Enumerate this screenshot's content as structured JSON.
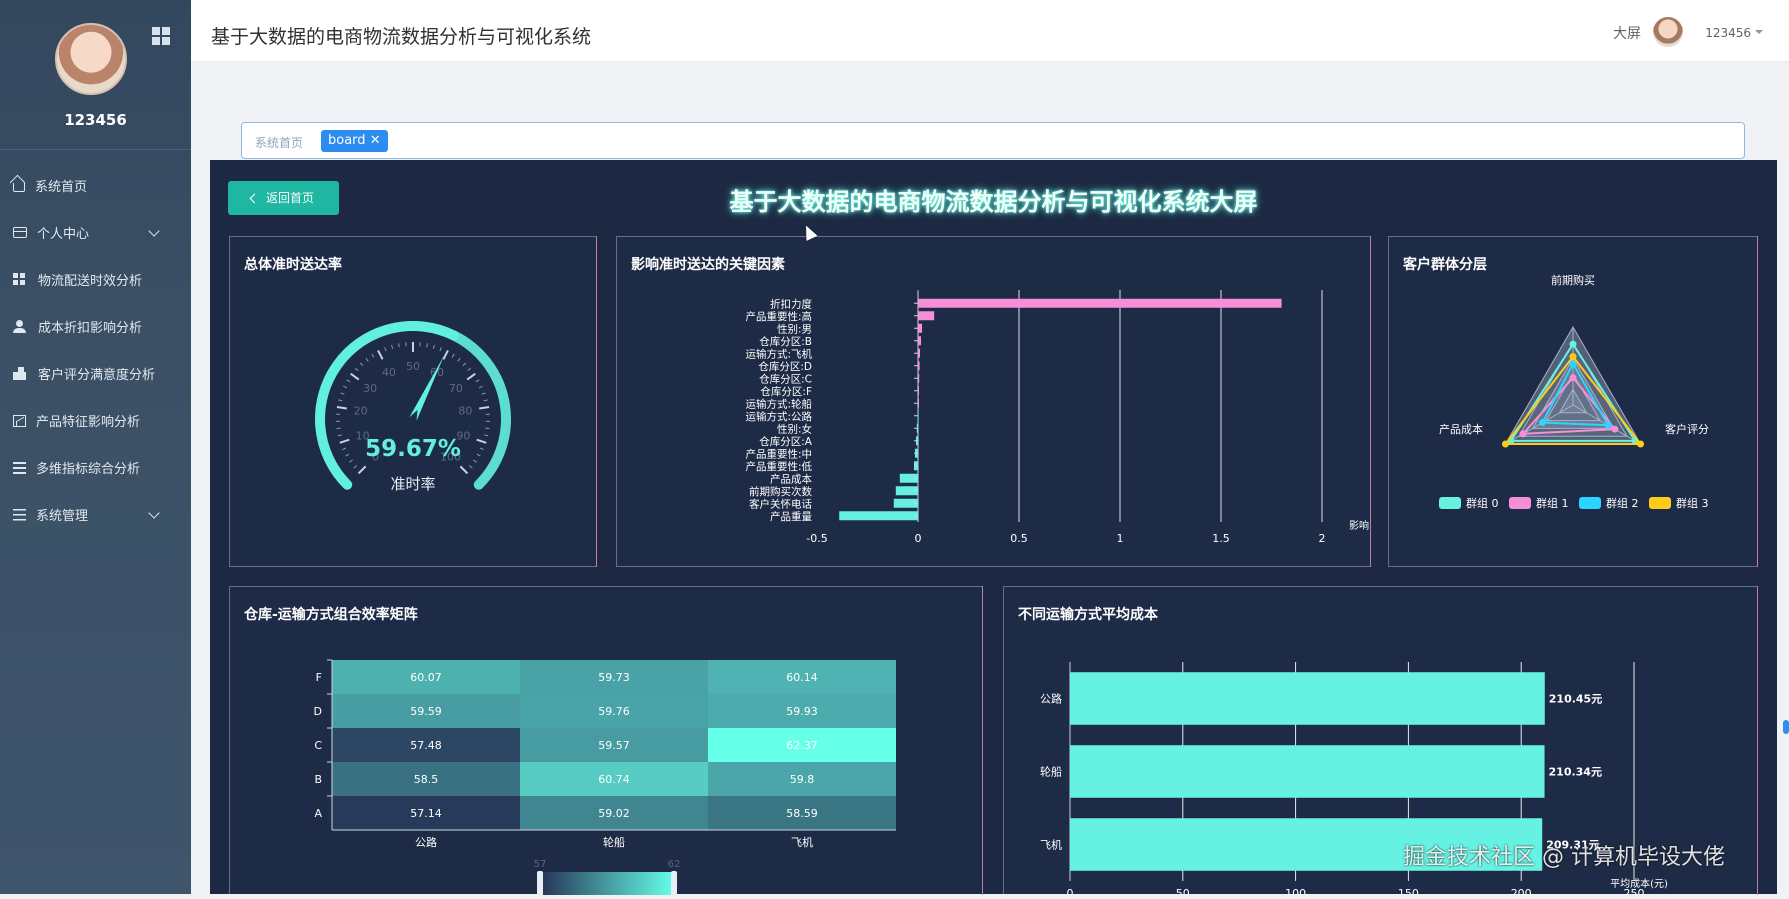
{
  "sidebar": {
    "username": "123456",
    "items": [
      {
        "icon": "home-icon",
        "label": "系统首页",
        "expand": false
      },
      {
        "icon": "id-card-icon",
        "label": "个人中心",
        "expand": true
      },
      {
        "icon": "grid-icon",
        "label": "物流配送时效分析",
        "expand": false
      },
      {
        "icon": "user-icon",
        "label": "成本折扣影响分析",
        "expand": false
      },
      {
        "icon": "hand-icon",
        "label": "客户评分满意度分析",
        "expand": false
      },
      {
        "icon": "line-chart-icon",
        "label": "产品特征影响分析",
        "expand": false
      },
      {
        "icon": "list-icon",
        "label": "多维指标综合分析",
        "expand": false
      },
      {
        "icon": "sliders-icon",
        "label": "系统管理",
        "expand": true
      }
    ]
  },
  "topbar": {
    "title": "基于大数据的电商物流数据分析与可视化系统",
    "big_screen": "大屏",
    "user": "123456"
  },
  "tags": {
    "crumb": "系统首页",
    "tag": "board"
  },
  "board": {
    "back": "返回首页",
    "title": "基于大数据的电商物流数据分析与可视化系统大屏"
  },
  "gauge": {
    "title": "总体准时送达率",
    "value": 59.67,
    "value_text": "59.67%",
    "label": "准时率",
    "min": 0,
    "max": 100,
    "ticks": [
      0,
      10,
      20,
      30,
      40,
      50,
      60,
      70,
      80,
      90,
      100
    ]
  },
  "factors": {
    "title": "影响准时送达的关键因素",
    "chart_data": {
      "type": "bar",
      "orientation": "horizontal",
      "categories": [
        "折扣力度",
        "产品重要性:高",
        "性别:男",
        "仓库分区:B",
        "运输方式:飞机",
        "仓库分区:D",
        "仓库分区:C",
        "仓库分区:F",
        "运输方式:轮船",
        "运输方式:公路",
        "性别:女",
        "仓库分区:A",
        "产品重要性:中",
        "产品重要性:低",
        "产品成本",
        "前期购买次数",
        "客户关怀电话",
        "产品重量"
      ],
      "values": [
        1.8,
        0.08,
        0.02,
        0.015,
        0.01,
        0.008,
        0.006,
        0.004,
        0.002,
        -0.002,
        -0.006,
        -0.01,
        -0.015,
        -0.02,
        -0.09,
        -0.11,
        -0.12,
        -0.39
      ],
      "xlabel": "影响",
      "xlim": [
        -0.5,
        2
      ],
      "xticks": [
        -0.5,
        0,
        0.5,
        1,
        1.5,
        2
      ],
      "colors": {
        "positive": "#f58fd8",
        "negative": "#66f0e1"
      }
    }
  },
  "radar": {
    "title": "客户群体分层",
    "chart_data": {
      "type": "radar",
      "indicators": [
        "前期购买",
        "客户评分",
        "产品成本"
      ],
      "series": [
        {
          "name": "群组 0",
          "color": "#66f2de",
          "values": [
            0.78,
            0.92,
            0.92
          ]
        },
        {
          "name": "群组 1",
          "color": "#f58fd8",
          "values": [
            0.35,
            0.62,
            0.74
          ]
        },
        {
          "name": "群组 2",
          "color": "#2ad6ff",
          "values": [
            0.53,
            0.52,
            0.45
          ]
        },
        {
          "name": "群组 3",
          "color": "#ffcc1a",
          "values": [
            0.62,
            1.0,
            1.0
          ]
        }
      ]
    }
  },
  "heatmap": {
    "title": "仓库-运输方式组合效率矩阵",
    "chart_data": {
      "type": "heatmap",
      "x": [
        "公路",
        "轮船",
        "飞机"
      ],
      "y": [
        "F",
        "D",
        "C",
        "B",
        "A"
      ],
      "values": [
        [
          60.07,
          59.73,
          60.14
        ],
        [
          59.59,
          59.76,
          59.93
        ],
        [
          57.48,
          59.57,
          62.37
        ],
        [
          58.5,
          60.74,
          59.8
        ],
        [
          57.14,
          59.02,
          58.59
        ]
      ],
      "visual_range": [
        57,
        62
      ],
      "range_labels": [
        "57",
        "62"
      ]
    }
  },
  "costbar": {
    "title": "不同运输方式平均成本",
    "chart_data": {
      "type": "bar",
      "orientation": "horizontal",
      "categories": [
        "公路",
        "轮船",
        "飞机"
      ],
      "values": [
        210.45,
        210.34,
        209.31
      ],
      "labels": [
        "210.45元",
        "210.34元",
        "209.31元"
      ],
      "xlabel": "平均成本(元)",
      "xlim": [
        0,
        250
      ],
      "xticks": [
        0,
        50,
        100,
        150,
        200,
        250
      ],
      "color": "#66f2e3"
    }
  },
  "watermark": "掘金技术社区 @ 计算机毕设大佬"
}
